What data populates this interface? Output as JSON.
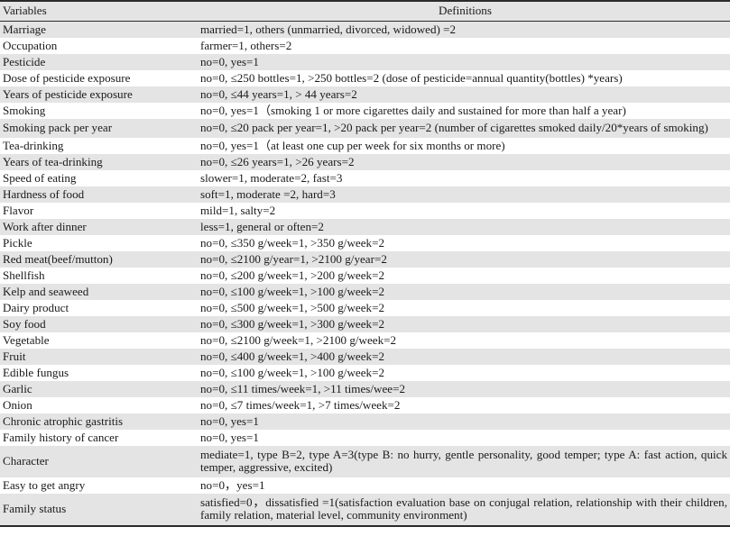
{
  "table": {
    "headers": {
      "variables": "Variables",
      "definitions": "Definitions"
    },
    "rows": [
      {
        "variable": "Marriage",
        "definition": "married=1, others (unmarried, divorced, widowed) =2",
        "multiline": false
      },
      {
        "variable": "Occupation",
        "definition": "farmer=1, others=2",
        "multiline": false
      },
      {
        "variable": "Pesticide",
        "definition": "no=0, yes=1",
        "multiline": false
      },
      {
        "variable": "Dose of pesticide exposure",
        "definition": "no=0, ≤250 bottles=1, >250 bottles=2 (dose of pesticide=annual quantity(bottles) *years)",
        "multiline": false
      },
      {
        "variable": "Years of pesticide exposure",
        "definition": "no=0, ≤44 years=1, > 44 years=2",
        "multiline": false
      },
      {
        "variable": "Smoking",
        "definition": "no=0, yes=1（smoking 1 or more cigarettes daily and sustained for more than half a year)",
        "multiline": false
      },
      {
        "variable": "Smoking pack per year",
        "definition": "no=0, ≤20 pack per year=1, >20 pack per year=2 (number of cigarettes smoked daily/20*years of smoking)",
        "multiline": true
      },
      {
        "variable": "Tea-drinking",
        "definition": "no=0, yes=1（at least one cup per week for six months or more)",
        "multiline": false
      },
      {
        "variable": "Years of tea-drinking",
        "definition": "no=0, ≤26 years=1, >26 years=2",
        "multiline": false
      },
      {
        "variable": "Speed of eating",
        "definition": "slower=1, moderate=2, fast=3",
        "multiline": false
      },
      {
        "variable": "Hardness of food",
        "definition": "soft=1, moderate =2, hard=3",
        "multiline": false
      },
      {
        "variable": "Flavor",
        "definition": "mild=1, salty=2",
        "multiline": false
      },
      {
        "variable": "Work after dinner",
        "definition": "less=1, general or often=2",
        "multiline": false
      },
      {
        "variable": "Pickle",
        "definition": "no=0, ≤350 g/week=1, >350 g/week=2",
        "multiline": false
      },
      {
        "variable": "Red meat(beef/mutton)",
        "definition": "no=0, ≤2100 g/year=1, >2100 g/year=2",
        "multiline": false
      },
      {
        "variable": "Shellfish",
        "definition": "no=0, ≤200 g/week=1, >200 g/week=2",
        "multiline": false
      },
      {
        "variable": "Kelp and seaweed",
        "definition": "no=0, ≤100 g/week=1, >100 g/week=2",
        "multiline": false
      },
      {
        "variable": "Dairy product",
        "definition": "no=0, ≤500 g/week=1, >500 g/week=2",
        "multiline": false
      },
      {
        "variable": "Soy food",
        "definition": "no=0, ≤300 g/week=1, >300 g/week=2",
        "multiline": false
      },
      {
        "variable": "Vegetable",
        "definition": "no=0, ≤2100 g/week=1, >2100 g/week=2",
        "multiline": false
      },
      {
        "variable": "Fruit",
        "definition": "no=0, ≤400 g/week=1, >400 g/week=2",
        "multiline": false
      },
      {
        "variable": "Edible fungus",
        "definition": "no=0, ≤100 g/week=1, >100 g/week=2",
        "multiline": false
      },
      {
        "variable": "Garlic",
        "definition": "no=0, ≤11 times/week=1, >11 times/wee=2",
        "multiline": false
      },
      {
        "variable": "Onion",
        "definition": "no=0, ≤7 times/week=1, >7 times/week=2",
        "multiline": false
      },
      {
        "variable": "Chronic atrophic gastritis",
        "definition": "no=0, yes=1",
        "multiline": false
      },
      {
        "variable": "Family history of cancer",
        "definition": "no=0, yes=1",
        "multiline": false
      },
      {
        "variable": "Character",
        "definition": "mediate=1, type B=2, type A=3(type B: no hurry, gentle personality, good temper; type A: fast action, quick temper, aggressive, excited)",
        "multiline": true
      },
      {
        "variable": "Easy to get angry",
        "definition": "no=0，yes=1",
        "multiline": false
      },
      {
        "variable": "Family status",
        "definition": "satisfied=0，dissatisfied =1(satisfaction evaluation base on conjugal relation, relationship with their children, family relation, material level, community environment)",
        "multiline": true
      }
    ]
  },
  "colors": {
    "shade_row": "#e4e4e4",
    "plain_row": "#ffffff",
    "rule": "#2b2b2b",
    "text": "#1a1a1a"
  }
}
